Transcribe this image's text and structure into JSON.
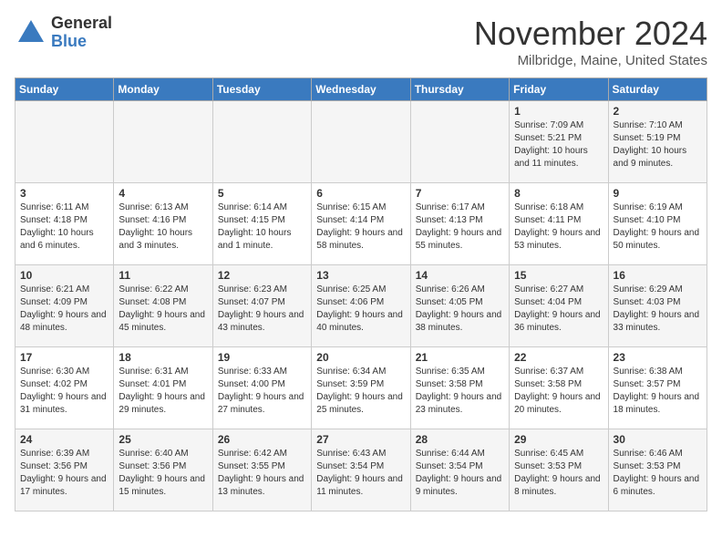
{
  "header": {
    "logo_general": "General",
    "logo_blue": "Blue",
    "month_title": "November 2024",
    "location": "Milbridge, Maine, United States"
  },
  "weekdays": [
    "Sunday",
    "Monday",
    "Tuesday",
    "Wednesday",
    "Thursday",
    "Friday",
    "Saturday"
  ],
  "weeks": [
    [
      {
        "day": "",
        "sunrise": "",
        "sunset": "",
        "daylight": ""
      },
      {
        "day": "",
        "sunrise": "",
        "sunset": "",
        "daylight": ""
      },
      {
        "day": "",
        "sunrise": "",
        "sunset": "",
        "daylight": ""
      },
      {
        "day": "",
        "sunrise": "",
        "sunset": "",
        "daylight": ""
      },
      {
        "day": "",
        "sunrise": "",
        "sunset": "",
        "daylight": ""
      },
      {
        "day": "1",
        "sunrise": "Sunrise: 7:09 AM",
        "sunset": "Sunset: 5:21 PM",
        "daylight": "Daylight: 10 hours and 11 minutes."
      },
      {
        "day": "2",
        "sunrise": "Sunrise: 7:10 AM",
        "sunset": "Sunset: 5:19 PM",
        "daylight": "Daylight: 10 hours and 9 minutes."
      }
    ],
    [
      {
        "day": "3",
        "sunrise": "Sunrise: 6:11 AM",
        "sunset": "Sunset: 4:18 PM",
        "daylight": "Daylight: 10 hours and 6 minutes."
      },
      {
        "day": "4",
        "sunrise": "Sunrise: 6:13 AM",
        "sunset": "Sunset: 4:16 PM",
        "daylight": "Daylight: 10 hours and 3 minutes."
      },
      {
        "day": "5",
        "sunrise": "Sunrise: 6:14 AM",
        "sunset": "Sunset: 4:15 PM",
        "daylight": "Daylight: 10 hours and 1 minute."
      },
      {
        "day": "6",
        "sunrise": "Sunrise: 6:15 AM",
        "sunset": "Sunset: 4:14 PM",
        "daylight": "Daylight: 9 hours and 58 minutes."
      },
      {
        "day": "7",
        "sunrise": "Sunrise: 6:17 AM",
        "sunset": "Sunset: 4:13 PM",
        "daylight": "Daylight: 9 hours and 55 minutes."
      },
      {
        "day": "8",
        "sunrise": "Sunrise: 6:18 AM",
        "sunset": "Sunset: 4:11 PM",
        "daylight": "Daylight: 9 hours and 53 minutes."
      },
      {
        "day": "9",
        "sunrise": "Sunrise: 6:19 AM",
        "sunset": "Sunset: 4:10 PM",
        "daylight": "Daylight: 9 hours and 50 minutes."
      }
    ],
    [
      {
        "day": "10",
        "sunrise": "Sunrise: 6:21 AM",
        "sunset": "Sunset: 4:09 PM",
        "daylight": "Daylight: 9 hours and 48 minutes."
      },
      {
        "day": "11",
        "sunrise": "Sunrise: 6:22 AM",
        "sunset": "Sunset: 4:08 PM",
        "daylight": "Daylight: 9 hours and 45 minutes."
      },
      {
        "day": "12",
        "sunrise": "Sunrise: 6:23 AM",
        "sunset": "Sunset: 4:07 PM",
        "daylight": "Daylight: 9 hours and 43 minutes."
      },
      {
        "day": "13",
        "sunrise": "Sunrise: 6:25 AM",
        "sunset": "Sunset: 4:06 PM",
        "daylight": "Daylight: 9 hours and 40 minutes."
      },
      {
        "day": "14",
        "sunrise": "Sunrise: 6:26 AM",
        "sunset": "Sunset: 4:05 PM",
        "daylight": "Daylight: 9 hours and 38 minutes."
      },
      {
        "day": "15",
        "sunrise": "Sunrise: 6:27 AM",
        "sunset": "Sunset: 4:04 PM",
        "daylight": "Daylight: 9 hours and 36 minutes."
      },
      {
        "day": "16",
        "sunrise": "Sunrise: 6:29 AM",
        "sunset": "Sunset: 4:03 PM",
        "daylight": "Daylight: 9 hours and 33 minutes."
      }
    ],
    [
      {
        "day": "17",
        "sunrise": "Sunrise: 6:30 AM",
        "sunset": "Sunset: 4:02 PM",
        "daylight": "Daylight: 9 hours and 31 minutes."
      },
      {
        "day": "18",
        "sunrise": "Sunrise: 6:31 AM",
        "sunset": "Sunset: 4:01 PM",
        "daylight": "Daylight: 9 hours and 29 minutes."
      },
      {
        "day": "19",
        "sunrise": "Sunrise: 6:33 AM",
        "sunset": "Sunset: 4:00 PM",
        "daylight": "Daylight: 9 hours and 27 minutes."
      },
      {
        "day": "20",
        "sunrise": "Sunrise: 6:34 AM",
        "sunset": "Sunset: 3:59 PM",
        "daylight": "Daylight: 9 hours and 25 minutes."
      },
      {
        "day": "21",
        "sunrise": "Sunrise: 6:35 AM",
        "sunset": "Sunset: 3:58 PM",
        "daylight": "Daylight: 9 hours and 23 minutes."
      },
      {
        "day": "22",
        "sunrise": "Sunrise: 6:37 AM",
        "sunset": "Sunset: 3:58 PM",
        "daylight": "Daylight: 9 hours and 20 minutes."
      },
      {
        "day": "23",
        "sunrise": "Sunrise: 6:38 AM",
        "sunset": "Sunset: 3:57 PM",
        "daylight": "Daylight: 9 hours and 18 minutes."
      }
    ],
    [
      {
        "day": "24",
        "sunrise": "Sunrise: 6:39 AM",
        "sunset": "Sunset: 3:56 PM",
        "daylight": "Daylight: 9 hours and 17 minutes."
      },
      {
        "day": "25",
        "sunrise": "Sunrise: 6:40 AM",
        "sunset": "Sunset: 3:56 PM",
        "daylight": "Daylight: 9 hours and 15 minutes."
      },
      {
        "day": "26",
        "sunrise": "Sunrise: 6:42 AM",
        "sunset": "Sunset: 3:55 PM",
        "daylight": "Daylight: 9 hours and 13 minutes."
      },
      {
        "day": "27",
        "sunrise": "Sunrise: 6:43 AM",
        "sunset": "Sunset: 3:54 PM",
        "daylight": "Daylight: 9 hours and 11 minutes."
      },
      {
        "day": "28",
        "sunrise": "Sunrise: 6:44 AM",
        "sunset": "Sunset: 3:54 PM",
        "daylight": "Daylight: 9 hours and 9 minutes."
      },
      {
        "day": "29",
        "sunrise": "Sunrise: 6:45 AM",
        "sunset": "Sunset: 3:53 PM",
        "daylight": "Daylight: 9 hours and 8 minutes."
      },
      {
        "day": "30",
        "sunrise": "Sunrise: 6:46 AM",
        "sunset": "Sunset: 3:53 PM",
        "daylight": "Daylight: 9 hours and 6 minutes."
      }
    ]
  ]
}
